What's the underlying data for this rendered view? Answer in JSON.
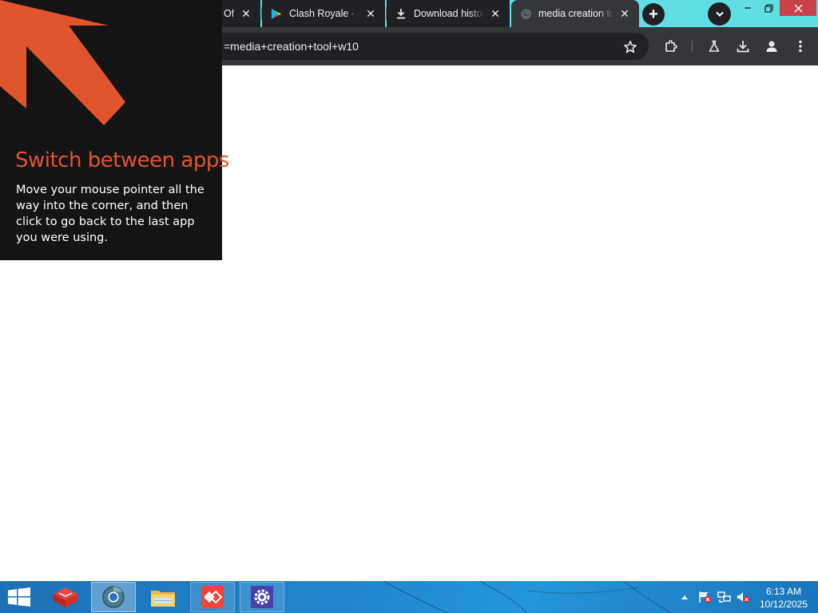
{
  "browser": {
    "tabs": [
      {
        "title": "Of",
        "icon": "tab-cutoff"
      },
      {
        "title": "Clash Royale - Ap",
        "icon": "google-play-icon"
      },
      {
        "title": "Download history",
        "icon": "download-icon"
      },
      {
        "title": "media creation tool",
        "icon": "globe-icon",
        "active": true
      }
    ],
    "new_tab_label": "+",
    "address_text": "=media+creation+tool+w10",
    "colors": {
      "tabstrip": "#5fdfe3",
      "toolbar": "#35363a",
      "tab_inactive": "#202124"
    }
  },
  "charm_tip": {
    "title": "Switch between apps",
    "body": "Move your mouse pointer all the way into the corner, and then click to go back to the last app you were using.",
    "accent": "#e0552e"
  },
  "taskbar": {
    "apps": [
      {
        "name": "red-cube-app-icon",
        "state": "normal"
      },
      {
        "name": "chrome-app-icon",
        "state": "active"
      },
      {
        "name": "file-explorer-icon",
        "state": "normal"
      },
      {
        "name": "anydesk-icon",
        "state": "open"
      },
      {
        "name": "settings-gear-icon",
        "state": "open"
      }
    ],
    "tray_icons": [
      "show-hidden-icons",
      "action-center-flag-icon",
      "network-icon",
      "volume-muted-icon"
    ],
    "time": "6:13 AM",
    "date": "10/12/2025"
  }
}
